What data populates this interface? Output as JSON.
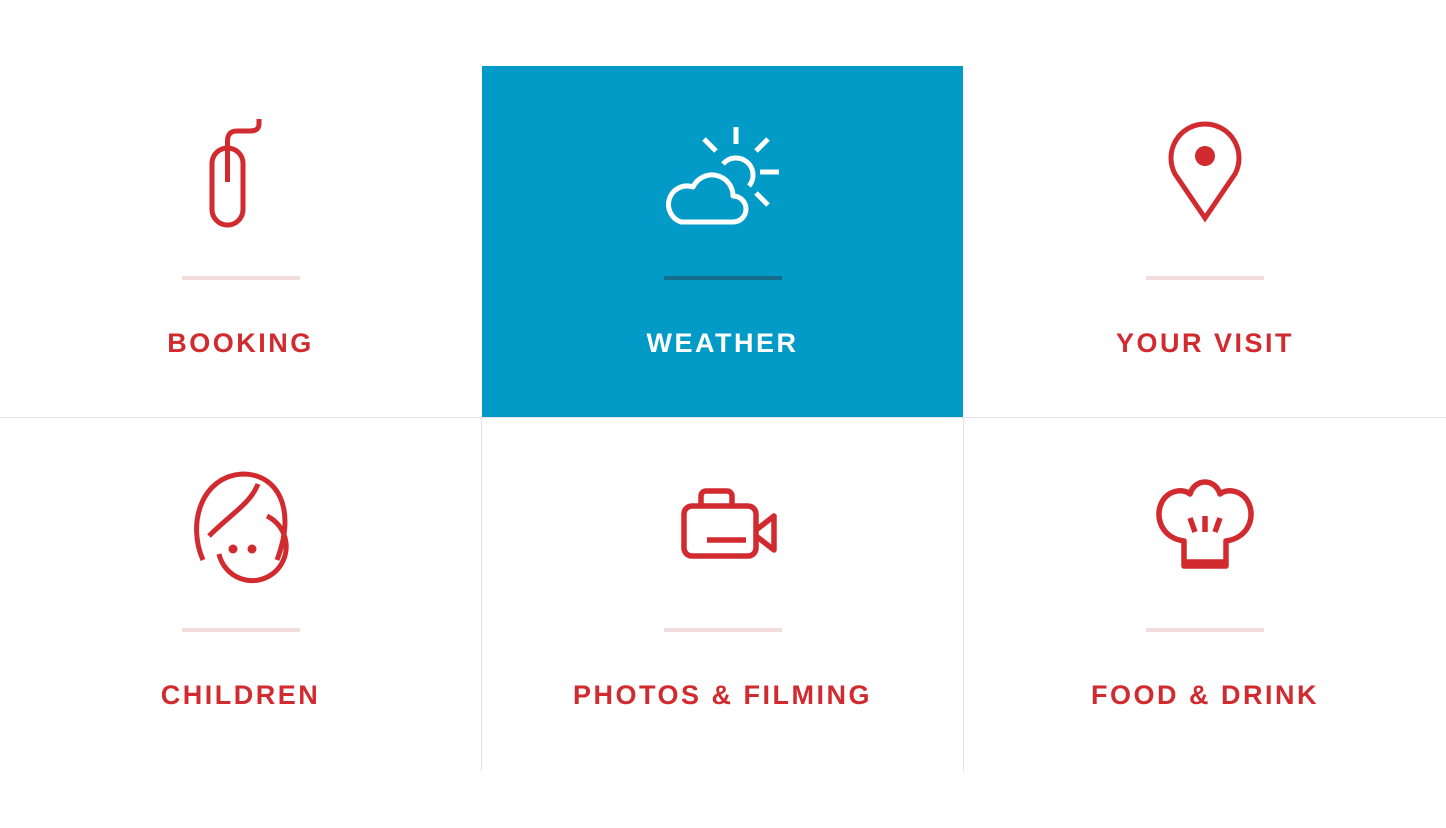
{
  "colors": {
    "accent": "#d12a2f",
    "active_background": "#029ac6",
    "active_text": "#ffffff",
    "divider": "#f5dcdc",
    "active_divider": "#166b8b",
    "grid_line": "#e2e2e2"
  },
  "tiles": [
    {
      "label": "BOOKING",
      "icon": "mouse-icon",
      "active": false
    },
    {
      "label": "WEATHER",
      "icon": "sun-cloud-icon",
      "active": true
    },
    {
      "label": "YOUR VISIT",
      "icon": "map-pin-icon",
      "active": false
    },
    {
      "label": "CHILDREN",
      "icon": "child-face-icon",
      "active": false
    },
    {
      "label": "PHOTOS & FILMING",
      "icon": "video-camera-icon",
      "active": false
    },
    {
      "label": "FOOD & DRINK",
      "icon": "chef-hat-icon",
      "active": false
    }
  ]
}
